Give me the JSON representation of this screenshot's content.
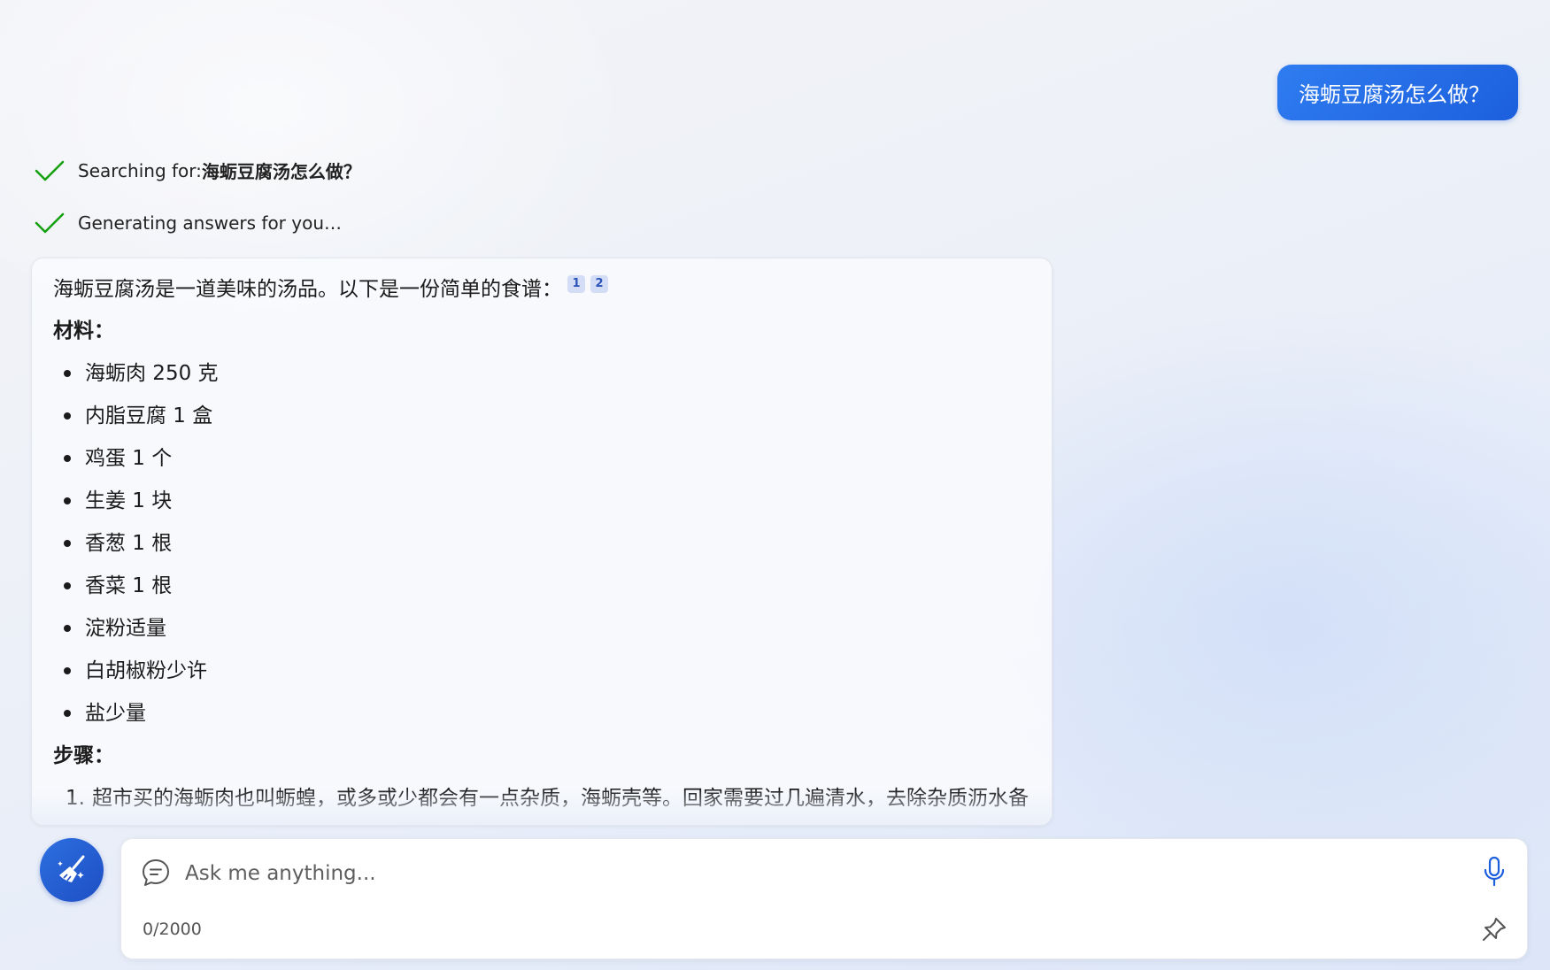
{
  "user_message": {
    "text": "海蛎豆腐汤怎么做？"
  },
  "status": {
    "searching_prefix": "Searching for: ",
    "searching_query": "海蛎豆腐汤怎么做？",
    "generating": "Generating answers for you…"
  },
  "answer": {
    "intro": "海蛎豆腐汤是一道美味的汤品。以下是一份简单的食谱：",
    "citations": [
      "1",
      "2"
    ],
    "ingredients_title": "材料：",
    "ingredients": [
      "海蛎肉 250 克",
      "内脂豆腐 1 盒",
      "鸡蛋 1 个",
      "生姜 1 块",
      "香葱 1 根",
      "香菜 1 根",
      "淀粉适量",
      "白胡椒粉少许",
      "盐少量"
    ],
    "steps_title": "步骤：",
    "steps": [
      {
        "num": "1.",
        "text": "超市买的海蛎肉也叫蛎蝗，或多或少都会有一点杂质，海蛎壳等。回家需要过几遍清水，去除杂质沥水备用"
      }
    ]
  },
  "composer": {
    "placeholder": "Ask me anything...",
    "counter": "0/2000"
  },
  "colors": {
    "accent": "#1c5fdd",
    "check_green": "#13a10e",
    "citation_bg": "#d3ddf6"
  },
  "icons": {
    "new_topic": "broom-icon",
    "chat": "chat-bubble-icon",
    "mic": "microphone-icon",
    "pin": "pin-icon",
    "status": "checkmark-icon"
  }
}
